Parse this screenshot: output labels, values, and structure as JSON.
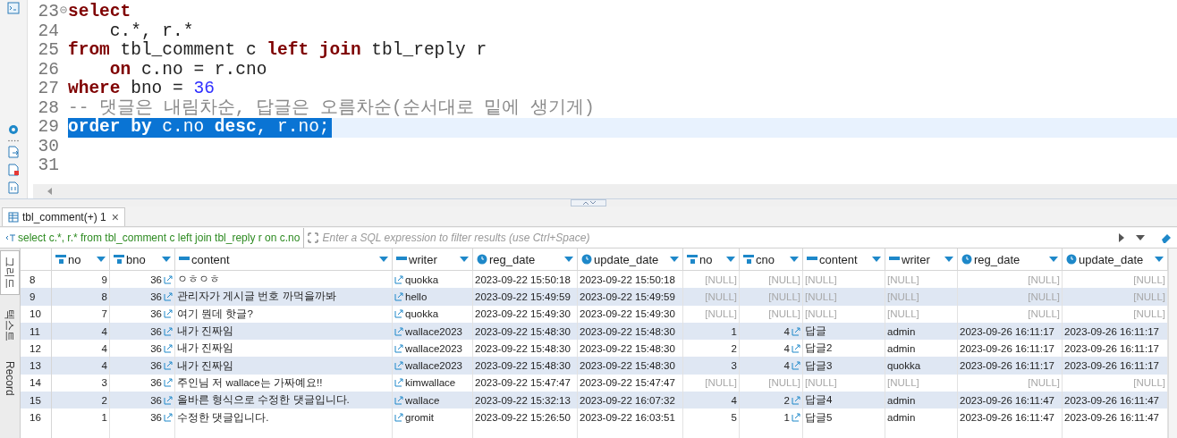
{
  "editor": {
    "lines": [
      {
        "number": "23",
        "foldable": true,
        "selected": false,
        "indent": false,
        "segments": [
          {
            "kind": "kw",
            "text": "select"
          }
        ]
      },
      {
        "number": "24",
        "foldable": false,
        "selected": false,
        "indent": true,
        "segments": [
          {
            "kind": "plain",
            "text": "c.*, r.*"
          }
        ]
      },
      {
        "number": "25",
        "foldable": false,
        "selected": false,
        "indent": false,
        "segments": [
          {
            "kind": "kw",
            "text": "from"
          },
          {
            "kind": "plain",
            "text": " tbl_comment c "
          },
          {
            "kind": "kw",
            "text": "left join"
          },
          {
            "kind": "plain",
            "text": " tbl_reply r"
          }
        ]
      },
      {
        "number": "26",
        "foldable": false,
        "selected": false,
        "indent": true,
        "segments": [
          {
            "kind": "kw",
            "text": "on"
          },
          {
            "kind": "plain",
            "text": " c.no = r.cno"
          }
        ]
      },
      {
        "number": "27",
        "foldable": false,
        "selected": false,
        "indent": false,
        "segments": [
          {
            "kind": "kw",
            "text": "where"
          },
          {
            "kind": "plain",
            "text": " bno = "
          },
          {
            "kind": "num",
            "text": "36"
          }
        ]
      },
      {
        "number": "28",
        "foldable": false,
        "selected": false,
        "indent": false,
        "segments": [
          {
            "kind": "comment",
            "text": "-- 댓글은 내림차순, 답글은 오름차순(순서대로 밑에 생기게)"
          }
        ]
      },
      {
        "number": "29",
        "foldable": false,
        "selected": true,
        "indent": false,
        "segments": [
          {
            "kind": "kw",
            "text": "order by"
          },
          {
            "kind": "plain",
            "text": " c.no "
          },
          {
            "kind": "kw",
            "text": "desc"
          },
          {
            "kind": "plain",
            "text": ", r.no;"
          }
        ]
      },
      {
        "number": "30",
        "foldable": false
      },
      {
        "number": "31",
        "foldable": false
      }
    ]
  },
  "results": {
    "tab": {
      "label": "tbl_comment(+) 1",
      "close": "×"
    },
    "filter": {
      "query": "select c.*, r.* from tbl_comment c left join tbl_reply r on c.no",
      "placeholder": "Enter a SQL expression to filter results (use Ctrl+Space)"
    },
    "view_tabs": [
      {
        "label": "그리드",
        "selected": true
      },
      {
        "label": "텍스트",
        "selected": false
      },
      {
        "label": "Record",
        "selected": false
      }
    ],
    "columns": [
      {
        "name": "no",
        "kind": "num",
        "link": false,
        "reply": false
      },
      {
        "name": "bno",
        "kind": "num",
        "link": true,
        "reply": false
      },
      {
        "name": "content",
        "kind": "text",
        "link": false,
        "reply": false
      },
      {
        "name": "writer",
        "kind": "text",
        "link": true,
        "reply": false
      },
      {
        "name": "reg_date",
        "kind": "date",
        "link": false,
        "reply": false
      },
      {
        "name": "update_date",
        "kind": "date",
        "link": false,
        "reply": false
      },
      {
        "name": "no",
        "kind": "num",
        "link": false,
        "reply": true
      },
      {
        "name": "cno",
        "kind": "num",
        "link": true,
        "reply": true
      },
      {
        "name": "content",
        "kind": "text",
        "link": false,
        "reply": true
      },
      {
        "name": "writer",
        "kind": "text",
        "link": false,
        "reply": true
      },
      {
        "name": "reg_date",
        "kind": "date",
        "link": false,
        "reply": true
      },
      {
        "name": "update_date",
        "kind": "date",
        "link": false,
        "reply": true
      }
    ],
    "rows": [
      {
        "number": "8",
        "joined": false,
        "cells": [
          "9",
          "36",
          "ㅇㅎㅇㅎ",
          "quokka",
          "2023-09-22 15:50:18",
          "2023-09-22 15:50:18",
          "[NULL]",
          "[NULL]",
          "[NULL]",
          "[NULL]",
          "[NULL]",
          "[NULL]"
        ]
      },
      {
        "number": "9",
        "joined": false,
        "cells": [
          "8",
          "36",
          "관리자가 게시글 번호 까먹을까봐",
          "hello",
          "2023-09-22 15:49:59",
          "2023-09-22 15:49:59",
          "[NULL]",
          "[NULL]",
          "[NULL]",
          "[NULL]",
          "[NULL]",
          "[NULL]"
        ]
      },
      {
        "number": "10",
        "joined": false,
        "cells": [
          "7",
          "36",
          "여기 뭔데 핫글?",
          "quokka",
          "2023-09-22 15:49:30",
          "2023-09-22 15:49:30",
          "[NULL]",
          "[NULL]",
          "[NULL]",
          "[NULL]",
          "[NULL]",
          "[NULL]"
        ]
      },
      {
        "number": "11",
        "joined": true,
        "cells": [
          "4",
          "36",
          "내가 진짜임",
          "wallace2023",
          "2023-09-22 15:48:30",
          "2023-09-22 15:48:30",
          "1",
          "4",
          "답글",
          "admin",
          "2023-09-26 16:11:17",
          "2023-09-26 16:11:17"
        ]
      },
      {
        "number": "12",
        "joined": true,
        "cells": [
          "4",
          "36",
          "내가 진짜임",
          "wallace2023",
          "2023-09-22 15:48:30",
          "2023-09-22 15:48:30",
          "2",
          "4",
          "답글2",
          "admin",
          "2023-09-26 16:11:17",
          "2023-09-26 16:11:17"
        ]
      },
      {
        "number": "13",
        "joined": true,
        "cells": [
          "4",
          "36",
          "내가 진짜임",
          "wallace2023",
          "2023-09-22 15:48:30",
          "2023-09-22 15:48:30",
          "3",
          "4",
          "답글3",
          "quokka",
          "2023-09-26 16:11:17",
          "2023-09-26 16:11:17"
        ]
      },
      {
        "number": "14",
        "joined": false,
        "cells": [
          "3",
          "36",
          "주인님 저 wallace는 가짜예요!!",
          "kimwallace",
          "2023-09-22 15:47:47",
          "2023-09-22 15:47:47",
          "[NULL]",
          "[NULL]",
          "[NULL]",
          "[NULL]",
          "[NULL]",
          "[NULL]"
        ]
      },
      {
        "number": "15",
        "joined": true,
        "cells": [
          "2",
          "36",
          "올바른 형식으로 수정한 댓글입니다.",
          "wallace",
          "2023-09-22 15:32:13",
          "2023-09-22 16:07:32",
          "4",
          "2",
          "답글4",
          "admin",
          "2023-09-26 16:11:47",
          "2023-09-26 16:11:47"
        ]
      },
      {
        "number": "16",
        "joined": true,
        "cells": [
          "1",
          "36",
          "수정한 댓글입니다.",
          "gromit",
          "2023-09-22 15:26:50",
          "2023-09-22 16:03:51",
          "5",
          "1",
          "답글5",
          "admin",
          "2023-09-26 16:11:47",
          "2023-09-26 16:11:47"
        ]
      }
    ]
  }
}
